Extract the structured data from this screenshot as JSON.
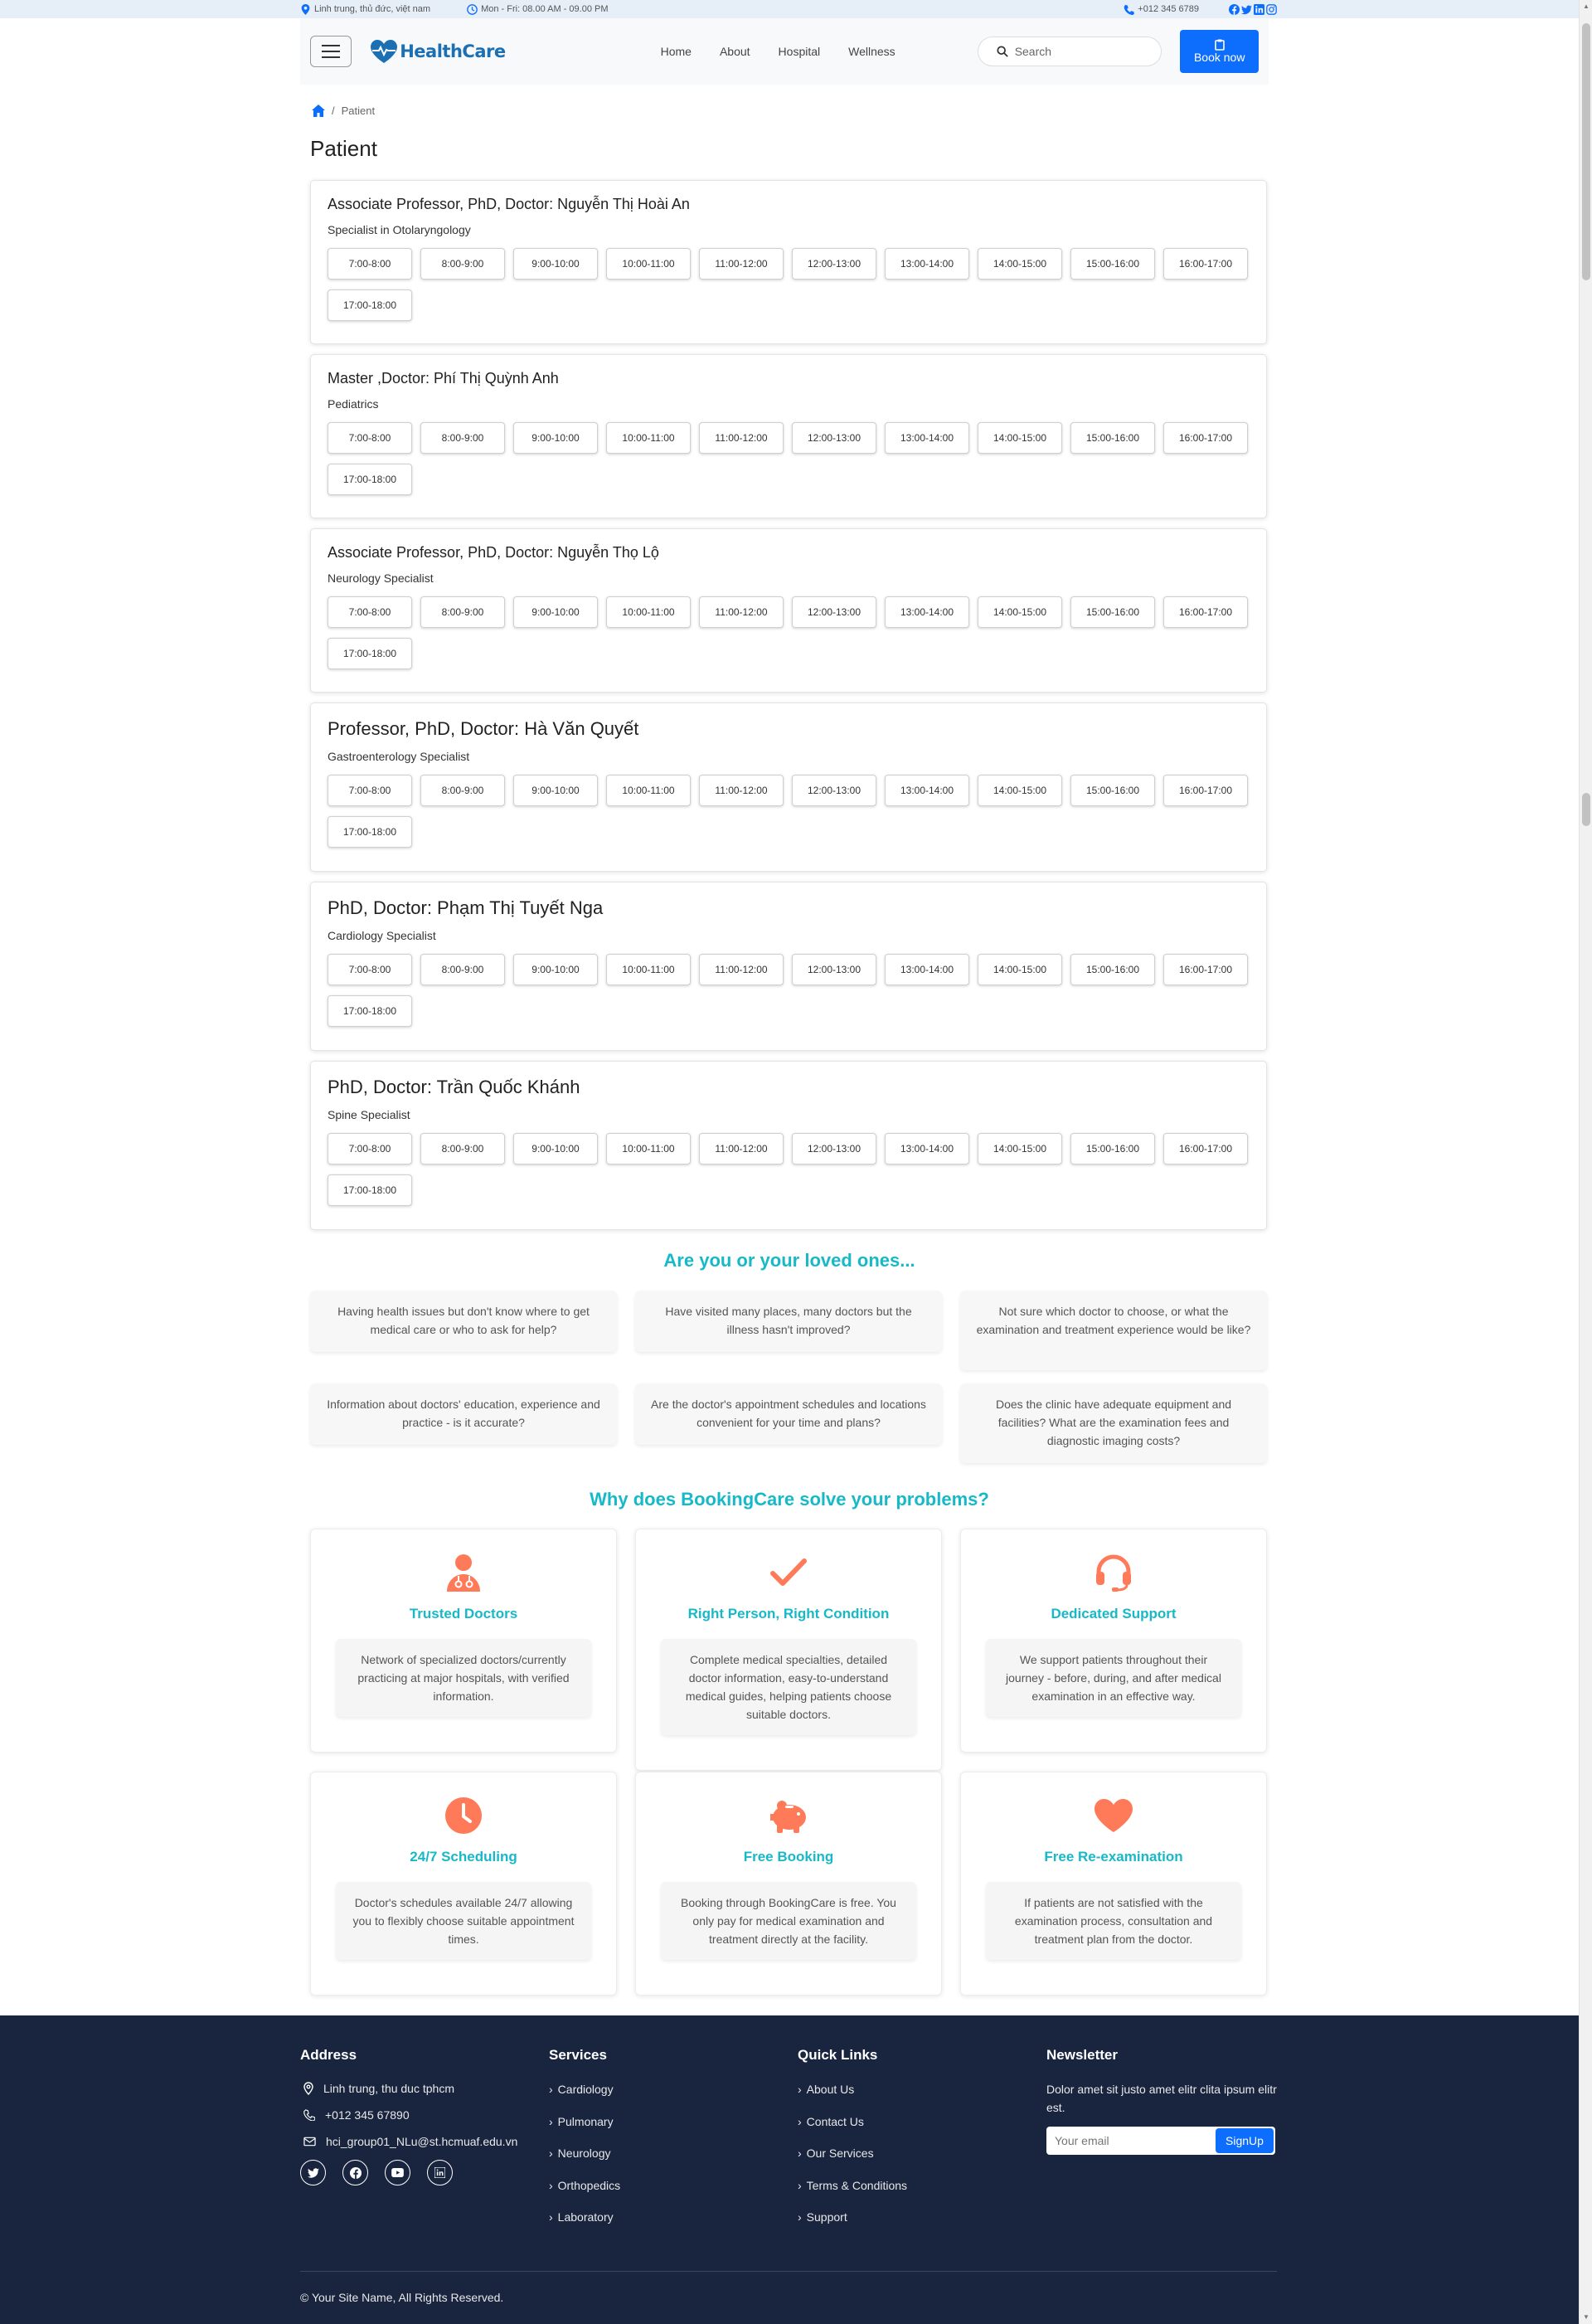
{
  "topbar": {
    "address": "Linh trung, thủ đức, việt nam",
    "hours": "Mon - Fri: 08.00 AM - 09.00 PM",
    "phone": "+012 345 6789"
  },
  "navbar": {
    "brand": "HealthCare",
    "links": [
      "Home",
      "About",
      "Hospital",
      "Wellness"
    ],
    "search_placeholder": "Search",
    "book_label": "Book now"
  },
  "breadcrumb": {
    "current": "Patient"
  },
  "page_title": "Patient",
  "time_slots": [
    "7:00-8:00",
    "8:00-9:00",
    "9:00-10:00",
    "10:00-11:00",
    "11:00-12:00",
    "12:00-13:00",
    "13:00-14:00",
    "14:00-15:00",
    "15:00-16:00",
    "16:00-17:00",
    "17:00-18:00"
  ],
  "doctors": [
    {
      "name": "Associate Professor, PhD, Doctor: Nguyễn Thị Hoài An",
      "specialty": "Specialist in Otolaryngology"
    },
    {
      "name": "Master ,Doctor: Phí Thị Quỳnh Anh",
      "specialty": "Pediatrics"
    },
    {
      "name": "Associate Professor, PhD, Doctor: Nguyễn Thọ Lộ",
      "specialty": "Neurology Specialist"
    },
    {
      "name": "Professor, PhD, Doctor: Hà Văn Quyết",
      "specialty": "Gastroenterology Specialist"
    },
    {
      "name": "PhD, Doctor: Phạm Thị Tuyết Nga",
      "specialty": "Cardiology Specialist"
    },
    {
      "name": "PhD, Doctor: Trần Quốc Khánh",
      "specialty": "Spine Specialist"
    }
  ],
  "questions": {
    "title": "Are you or your loved ones...",
    "items": [
      "Having health issues but don't know where to get medical care or who to ask for help?",
      "Have visited many places, many doctors but the illness hasn't improved?",
      "Not sure which doctor to choose, or what the examination and treatment experience would be like?",
      "Information about doctors' education, experience and practice - is it accurate?",
      "Are the doctor's appointment schedules and locations convenient for your time and plans?",
      "Does the clinic have adequate equipment and facilities? What are the examination fees and diagnostic imaging costs?"
    ]
  },
  "features": {
    "title": "Why does BookingCare solve your problems?",
    "accent_color": "#ff7a59",
    "items": [
      {
        "icon": "doctor-icon",
        "title": "Trusted Doctors",
        "desc": "Network of specialized doctors/currently practicing at major hospitals, with verified information."
      },
      {
        "icon": "check-icon",
        "title": "Right Person, Right Condition",
        "desc": "Complete medical specialties, detailed doctor information, easy-to-understand medical guides, helping patients choose suitable doctors."
      },
      {
        "icon": "headset-icon",
        "title": "Dedicated Support",
        "desc": "We support patients throughout their journey - before, during, and after medical examination in an effective way."
      },
      {
        "icon": "clock-icon",
        "title": "24/7 Scheduling",
        "desc": "Doctor's schedules available 24/7 allowing you to flexibly choose suitable appointment times."
      },
      {
        "icon": "piggy-bank-icon",
        "title": "Free Booking",
        "desc": "Booking through BookingCare is free. You only pay for medical examination and treatment directly at the facility."
      },
      {
        "icon": "heart-icon",
        "title": "Free Re-examination",
        "desc": "If patients are not satisfied with the examination process, consultation and treatment plan from the doctor."
      }
    ]
  },
  "footer": {
    "address": {
      "heading": "Address",
      "location": "Linh trung, thu duc tphcm",
      "phone": "+012 345 67890",
      "email": "hci_group01_NLu@st.hcmuaf.edu.vn"
    },
    "services": {
      "heading": "Services",
      "items": [
        "Cardiology",
        "Pulmonary",
        "Neurology",
        "Orthopedics",
        "Laboratory"
      ]
    },
    "quick_links": {
      "heading": "Quick Links",
      "items": [
        "About Us",
        "Contact Us",
        "Our Services",
        "Terms & Conditions",
        "Support"
      ]
    },
    "newsletter": {
      "heading": "Newsletter",
      "text": "Dolor amet sit justo amet elitr clita ipsum elitr est.",
      "email_placeholder": "Your email",
      "button": "SignUp"
    },
    "copyright": "© Your Site Name, All Rights Reserved."
  },
  "colors": {
    "primary": "#0d6efd",
    "teal": "#17b9c8",
    "footer_bg": "#19253f",
    "topbar_bg": "#e6eef8"
  }
}
